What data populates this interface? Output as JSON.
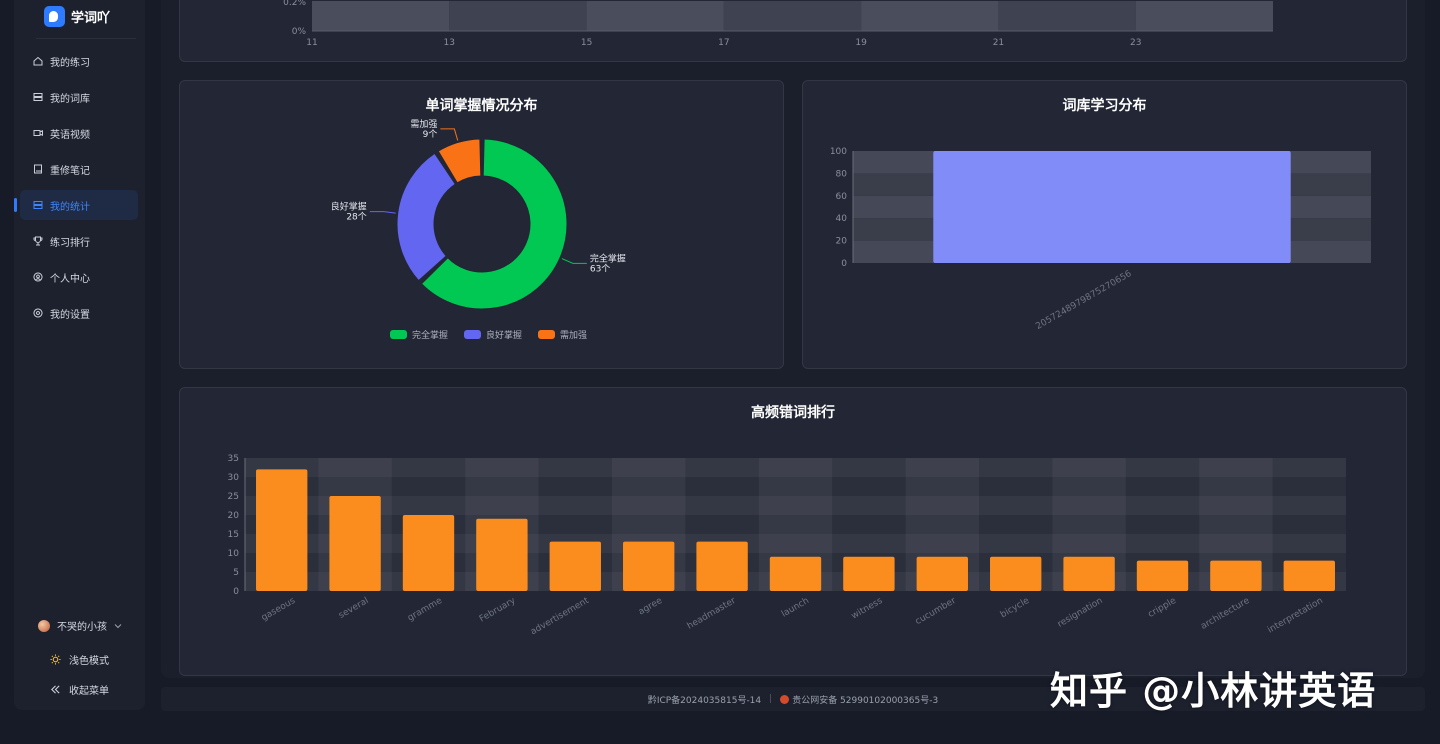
{
  "app": {
    "name": "学词吖"
  },
  "sidebar": {
    "items": [
      {
        "label": "我的练习",
        "icon": "home-icon"
      },
      {
        "label": "我的词库",
        "icon": "database-icon"
      },
      {
        "label": "英语视频",
        "icon": "video-icon"
      },
      {
        "label": "重修笔记",
        "icon": "book-icon"
      },
      {
        "label": "我的统计",
        "icon": "stats-icon",
        "active": true
      },
      {
        "label": "练习排行",
        "icon": "trophy-icon"
      },
      {
        "label": "个人中心",
        "icon": "user-icon"
      },
      {
        "label": "我的设置",
        "icon": "settings-icon"
      }
    ],
    "user_name": "不哭的小孩",
    "theme_label": "浅色模式",
    "collapse_label": "收起菜单"
  },
  "top_chart": {
    "y_ticks": [
      "0.2%",
      "0%"
    ],
    "x_ticks": [
      "11",
      "13",
      "15",
      "17",
      "19",
      "21",
      "23"
    ]
  },
  "charts": {
    "donut": {
      "title": "单词掌握情况分布"
    },
    "library": {
      "title": "词库学习分布"
    },
    "errors": {
      "title": "高频错词排行"
    }
  },
  "chart_data": [
    {
      "type": "pie",
      "title": "单词掌握情况分布",
      "categories": [
        "完全掌握",
        "良好掌握",
        "需加强"
      ],
      "values": [
        63,
        28,
        9
      ],
      "value_labels": [
        "63个",
        "28个",
        "9个"
      ],
      "colors": [
        "#00c853",
        "#6366f1",
        "#f97316"
      ],
      "legend": "bottom",
      "donut": true
    },
    {
      "type": "bar",
      "title": "词库学习分布",
      "categories": [
        "2057248979875270656"
      ],
      "values": [
        100
      ],
      "ylim": [
        0,
        100
      ],
      "y_ticks": [
        0,
        20,
        40,
        60,
        80,
        100
      ],
      "color": "#818cf8"
    },
    {
      "type": "bar",
      "title": "高频错词排行",
      "categories": [
        "gaseous",
        "several",
        "gramme",
        "February",
        "advertisement",
        "agree",
        "headmaster",
        "launch",
        "witness",
        "cucumber",
        "bicycle",
        "resignation",
        "cripple",
        "architecture",
        "interpretation"
      ],
      "values": [
        32,
        25,
        20,
        19,
        13,
        13,
        13,
        9,
        9,
        9,
        9,
        9,
        8,
        8,
        8
      ],
      "ylim": [
        0,
        35
      ],
      "y_ticks": [
        0,
        5,
        10,
        15,
        20,
        25,
        30,
        35
      ],
      "color": "#fb8c1e"
    }
  ],
  "footer": {
    "icp": "黔ICP备2024035815号-14",
    "separator": "|",
    "police": "贵公网安备 52990102000365号-3"
  },
  "watermark": "知乎 @小林讲英语"
}
